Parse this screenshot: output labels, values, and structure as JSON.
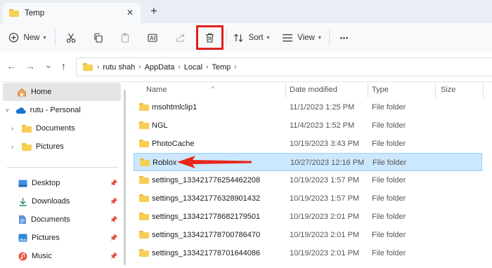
{
  "window": {
    "tab_title": "Temp",
    "close_glyph": "✕",
    "new_tab_glyph": "+"
  },
  "toolbar": {
    "new_label": "New",
    "sort_label": "Sort",
    "view_label": "View",
    "more_glyph": "•••",
    "icons": [
      "cut-icon",
      "copy-icon",
      "paste-icon",
      "rename-icon",
      "share-icon",
      "delete-icon"
    ]
  },
  "nav": {
    "back": "←",
    "forward": "→",
    "recent": "⌄",
    "up": "↑"
  },
  "breadcrumb": [
    "rutu shah",
    "AppData",
    "Local",
    "Temp"
  ],
  "sidebar": {
    "home": "Home",
    "onedrive": "rutu - Personal",
    "items": [
      "Documents",
      "Pictures"
    ],
    "quick": [
      "Desktop",
      "Downloads",
      "Documents",
      "Pictures",
      "Music"
    ]
  },
  "columns": {
    "name": "Name",
    "date": "Date modified",
    "type": "Type",
    "size": "Size"
  },
  "files": [
    {
      "name": "msohtmlclip1",
      "date": "11/1/2023 1:25 PM",
      "type": "File folder"
    },
    {
      "name": "NGL",
      "date": "11/4/2023 1:52 PM",
      "type": "File folder"
    },
    {
      "name": "PhotoCache",
      "date": "10/19/2023 3:43 PM",
      "type": "File folder"
    },
    {
      "name": "Roblox",
      "date": "10/27/2023 12:16 PM",
      "type": "File folder"
    },
    {
      "name": "settings_133421776254462208",
      "date": "10/19/2023 1:57 PM",
      "type": "File folder"
    },
    {
      "name": "settings_133421776328901432",
      "date": "10/19/2023 1:57 PM",
      "type": "File folder"
    },
    {
      "name": "settings_133421778682179501",
      "date": "10/19/2023 2:01 PM",
      "type": "File folder"
    },
    {
      "name": "settings_133421778700786470",
      "date": "10/19/2023 2:01 PM",
      "type": "File folder"
    },
    {
      "name": "settings_133421778701644086",
      "date": "10/19/2023 2:01 PM",
      "type": "File folder"
    }
  ],
  "colors": {
    "selection": "#cce8ff",
    "highlight_box": "#e0201e",
    "arrow": "#e8261c"
  }
}
